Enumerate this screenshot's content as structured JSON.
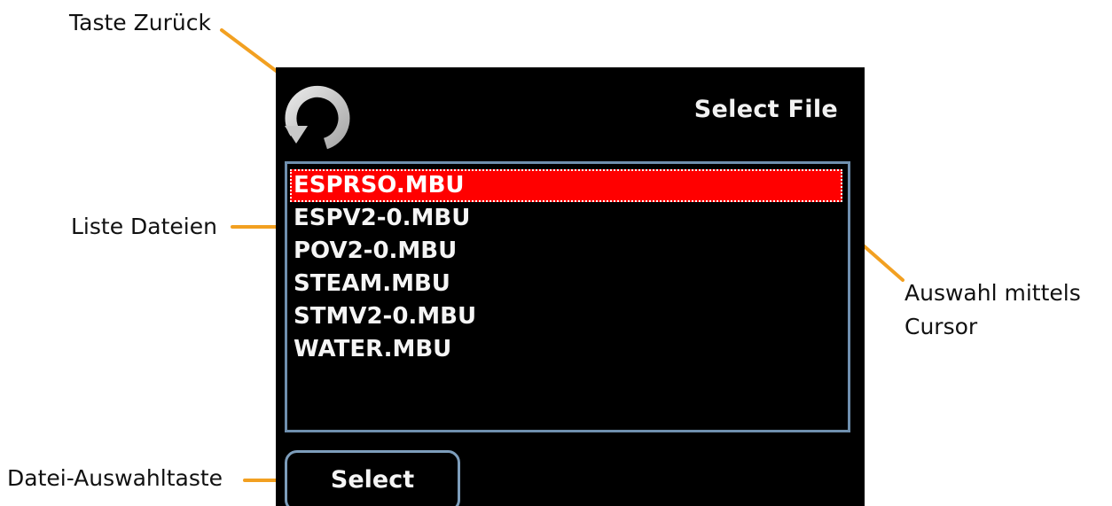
{
  "callouts": {
    "back_key": "Taste Zurück",
    "file_list": "Liste Dateien",
    "cursor_line1": "Auswahl mittels",
    "cursor_line2": "Cursor",
    "select_key": "Datei-Auswahltaste"
  },
  "screen": {
    "title": "Select File",
    "back_icon": "rotate-back-icon",
    "files": [
      {
        "name": "ESPRSO.MBU",
        "selected": true
      },
      {
        "name": "ESPV2-0.MBU",
        "selected": false
      },
      {
        "name": "POV2-0.MBU",
        "selected": false
      },
      {
        "name": "STEAM.MBU",
        "selected": false
      },
      {
        "name": "STMV2-0.MBU",
        "selected": false
      },
      {
        "name": "WATER.MBU",
        "selected": false
      }
    ],
    "select_label": "Select"
  },
  "colors": {
    "screen_background": "#000000",
    "highlight": "#ff0000",
    "frame_border": "#6f8fae",
    "leader_line": "#f2a021",
    "icon_fill": "#c9c9c9"
  }
}
